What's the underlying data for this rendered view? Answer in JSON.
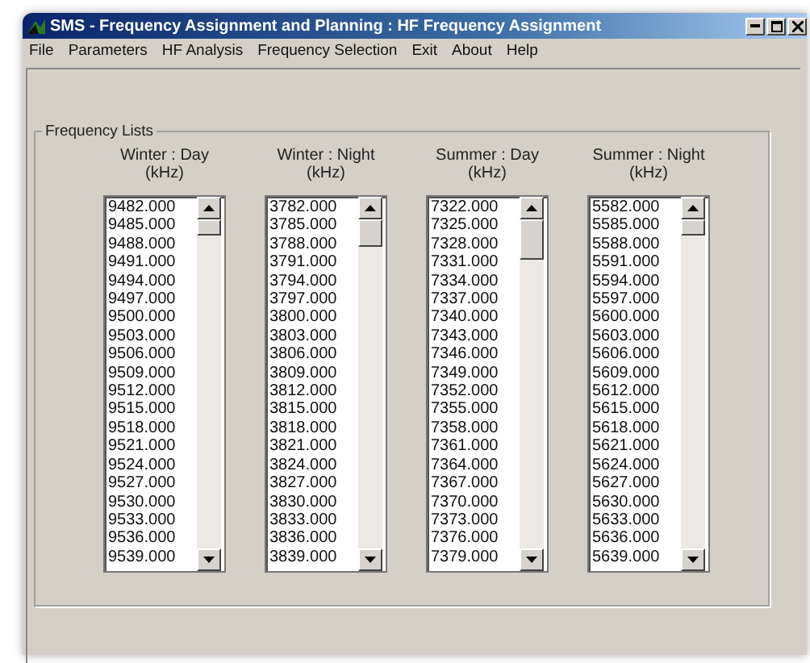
{
  "window": {
    "title": "SMS - Frequency Assignment and Planning : HF Frequency Assignment"
  },
  "menu": [
    "File",
    "Parameters",
    "HF Analysis",
    "Frequency Selection",
    "Exit",
    "About",
    "Help"
  ],
  "group": {
    "title": "Frequency Lists"
  },
  "lists": [
    {
      "heading": "Winter : Day",
      "unit": "(kHz)",
      "items": [
        "9482.000",
        "9485.000",
        "9488.000",
        "9491.000",
        "9494.000",
        "9497.000",
        "9500.000",
        "9503.000",
        "9506.000",
        "9509.000",
        "9512.000",
        "9515.000",
        "9518.000",
        "9521.000",
        "9524.000",
        "9527.000",
        "9530.000",
        "9533.000",
        "9536.000",
        "9539.000"
      ]
    },
    {
      "heading": "Winter : Night",
      "unit": "(kHz)",
      "items": [
        "3782.000",
        "3785.000",
        "3788.000",
        "3791.000",
        "3794.000",
        "3797.000",
        "3800.000",
        "3803.000",
        "3806.000",
        "3809.000",
        "3812.000",
        "3815.000",
        "3818.000",
        "3821.000",
        "3824.000",
        "3827.000",
        "3830.000",
        "3833.000",
        "3836.000",
        "3839.000"
      ]
    },
    {
      "heading": "Summer : Day",
      "unit": "(kHz)",
      "items": [
        "7322.000",
        "7325.000",
        "7328.000",
        "7331.000",
        "7334.000",
        "7337.000",
        "7340.000",
        "7343.000",
        "7346.000",
        "7349.000",
        "7352.000",
        "7355.000",
        "7358.000",
        "7361.000",
        "7364.000",
        "7367.000",
        "7370.000",
        "7373.000",
        "7376.000",
        "7379.000"
      ]
    },
    {
      "heading": "Summer : Night",
      "unit": "(kHz)",
      "items": [
        "5582.000",
        "5585.000",
        "5588.000",
        "5591.000",
        "5594.000",
        "5597.000",
        "5600.000",
        "5603.000",
        "5606.000",
        "5609.000",
        "5612.000",
        "5615.000",
        "5618.000",
        "5621.000",
        "5624.000",
        "5627.000",
        "5630.000",
        "5633.000",
        "5636.000",
        "5639.000"
      ]
    }
  ]
}
